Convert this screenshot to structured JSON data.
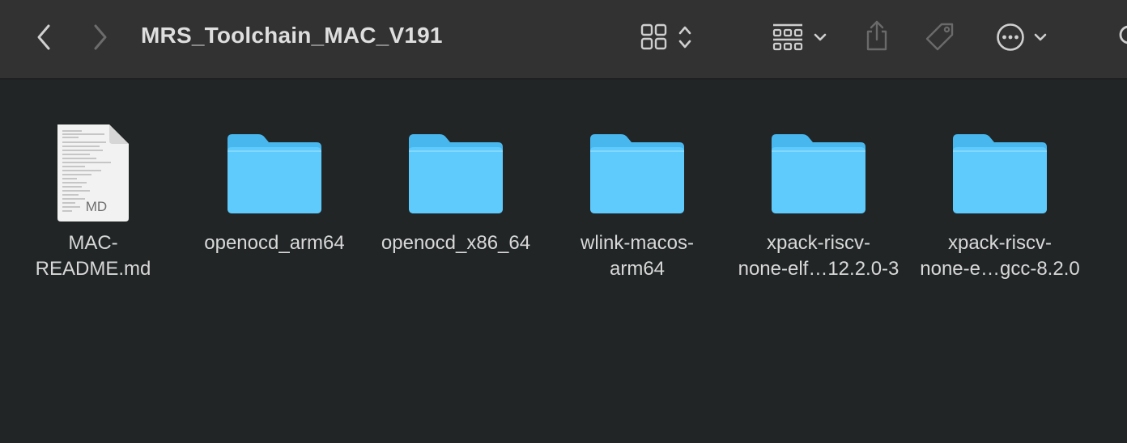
{
  "window": {
    "title": "MRS_Toolchain_MAC_V191"
  },
  "toolbar": {
    "back_icon": "chevron-left-icon",
    "forward_icon": "chevron-right-icon",
    "view_icon": "icon-grid-icon",
    "group_icon": "group-by-icon",
    "share_icon": "share-icon",
    "tag_icon": "tag-icon",
    "more_icon": "ellipsis-circle-icon"
  },
  "colors": {
    "toolbar_bg": "#323233",
    "content_bg": "#212526",
    "folder_blue": "#5fc9fb",
    "folder_tab": "#48b7ee",
    "text": "#d8d8d8"
  },
  "items": [
    {
      "kind": "document",
      "badge": "MD",
      "label_lines": [
        "MAC-",
        "README.md"
      ]
    },
    {
      "kind": "folder",
      "label_lines": [
        "openocd_arm64"
      ]
    },
    {
      "kind": "folder",
      "label_lines": [
        "openocd_x86_64"
      ]
    },
    {
      "kind": "folder",
      "label_lines": [
        "wlink-macos-",
        "arm64"
      ]
    },
    {
      "kind": "folder",
      "label_lines": [
        "xpack-riscv-",
        "none-elf…12.2.0-3"
      ]
    },
    {
      "kind": "folder",
      "label_lines": [
        "xpack-riscv-",
        "none-e…gcc-8.2.0"
      ]
    }
  ]
}
